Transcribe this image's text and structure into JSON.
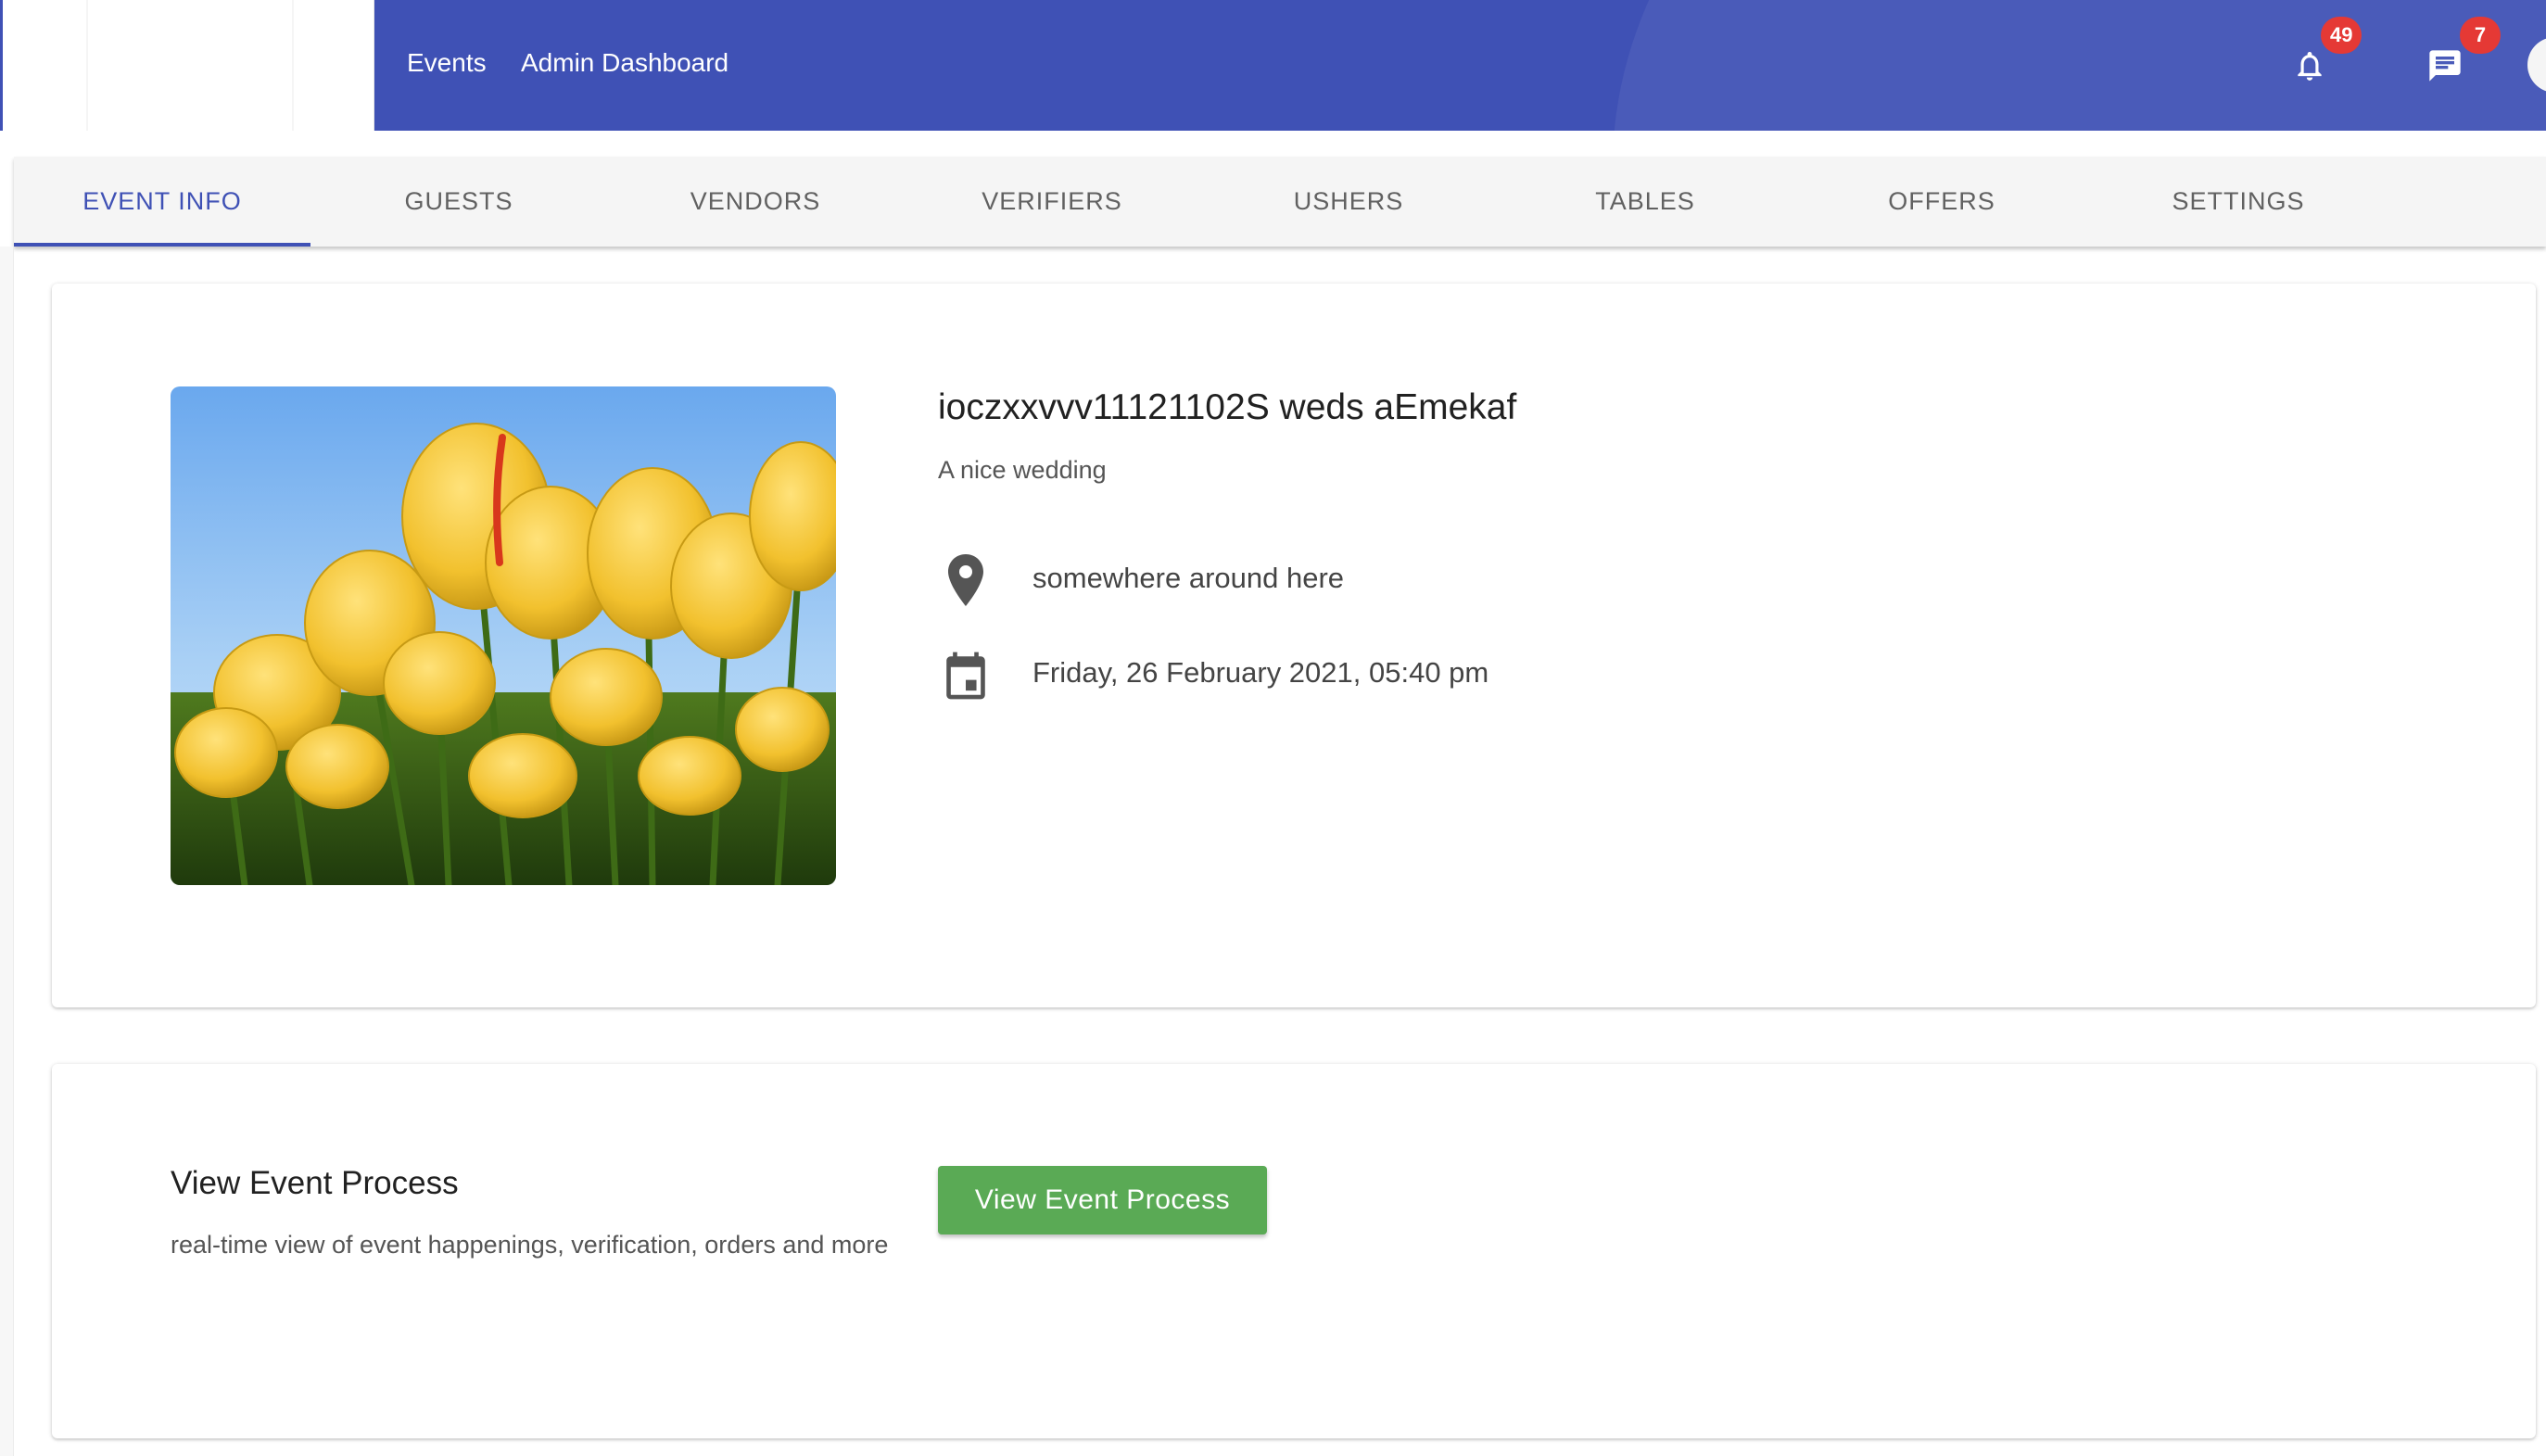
{
  "header": {
    "nav": [
      "Events",
      "Admin Dashboard"
    ],
    "notifications_count": "49",
    "messages_count": "7",
    "icons": [
      "bell-icon",
      "chat-icon",
      "avatar"
    ],
    "bar_color": "#3f51b5"
  },
  "tabs": [
    {
      "label": "EVENT INFO",
      "active": true
    },
    {
      "label": "GUESTS",
      "active": false
    },
    {
      "label": "VENDORS",
      "active": false
    },
    {
      "label": "VERIFIERS",
      "active": false
    },
    {
      "label": "USHERS",
      "active": false
    },
    {
      "label": "TABLES",
      "active": false
    },
    {
      "label": "OFFERS",
      "active": false
    },
    {
      "label": "SETTINGS",
      "active": false
    }
  ],
  "event": {
    "title": "ioczxxvvv11121102S weds aEmekaf",
    "description": "A nice wedding",
    "location": "somewhere around here",
    "datetime": "Friday, 26 February 2021, 05:40 pm",
    "image": "yellow tulips photo",
    "location_icon": "map-pin-icon",
    "date_icon": "calendar-icon"
  },
  "process": {
    "title": "View Event Process",
    "description": "real-time view of event happenings, verification, orders and more",
    "button_label": "View Event Process",
    "button_color": "#5aaa55"
  }
}
